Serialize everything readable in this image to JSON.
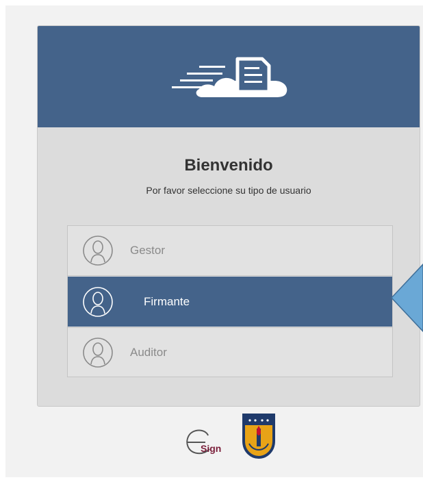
{
  "header": {
    "logo_icon": "cloud-document-icon",
    "color": "#44638a"
  },
  "welcome": {
    "title": "Bienvenido",
    "subtitle": "Por favor seleccione su tipo de usuario"
  },
  "roles": [
    {
      "label": "Gestor",
      "icon": "user-icon",
      "selected": false
    },
    {
      "label": "Firmante",
      "icon": "user-icon",
      "selected": true
    },
    {
      "label": "Auditor",
      "icon": "user-icon",
      "selected": false
    }
  ],
  "footer": {
    "esign_label": "Sign",
    "esign_logo": "esign-logo-icon",
    "shield_logo": "university-shield-icon"
  },
  "colors": {
    "selected": "#44638a",
    "arrow": "#6aa8d6"
  }
}
